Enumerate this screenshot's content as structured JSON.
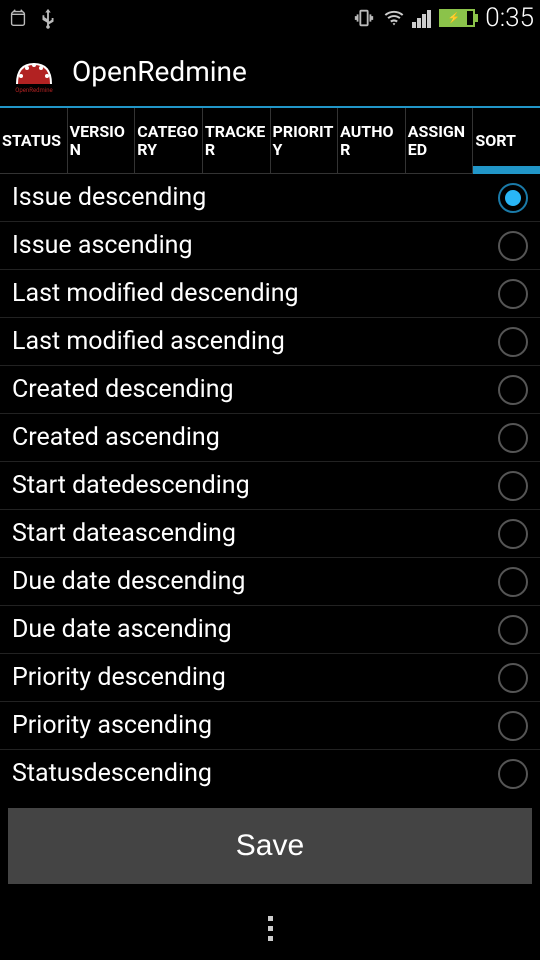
{
  "statusBar": {
    "time": "0:35"
  },
  "app": {
    "title": "OpenRedmine"
  },
  "tabs": [
    {
      "label": "STATUS",
      "active": false
    },
    {
      "label": "VERSION",
      "active": false
    },
    {
      "label": "CATEGORY",
      "active": false
    },
    {
      "label": "TRACKER",
      "active": false
    },
    {
      "label": "PRIORITY",
      "active": false
    },
    {
      "label": "AUTHOR",
      "active": false
    },
    {
      "label": "ASSIGNED",
      "active": false
    },
    {
      "label": "SORT",
      "active": true
    }
  ],
  "sortOptions": [
    {
      "label": "Issue  descending",
      "selected": true
    },
    {
      "label": "Issue  ascending",
      "selected": false
    },
    {
      "label": "Last modified  descending",
      "selected": false
    },
    {
      "label": "Last modified  ascending",
      "selected": false
    },
    {
      "label": "Created descending",
      "selected": false
    },
    {
      "label": "Created ascending",
      "selected": false
    },
    {
      "label": "Start datedescending",
      "selected": false
    },
    {
      "label": "Start dateascending",
      "selected": false
    },
    {
      "label": "Due date  descending",
      "selected": false
    },
    {
      "label": "Due date  ascending",
      "selected": false
    },
    {
      "label": "Priority  descending",
      "selected": false
    },
    {
      "label": "Priority  ascending",
      "selected": false
    },
    {
      "label": "Statusdescending",
      "selected": false
    }
  ],
  "saveButton": "Save"
}
